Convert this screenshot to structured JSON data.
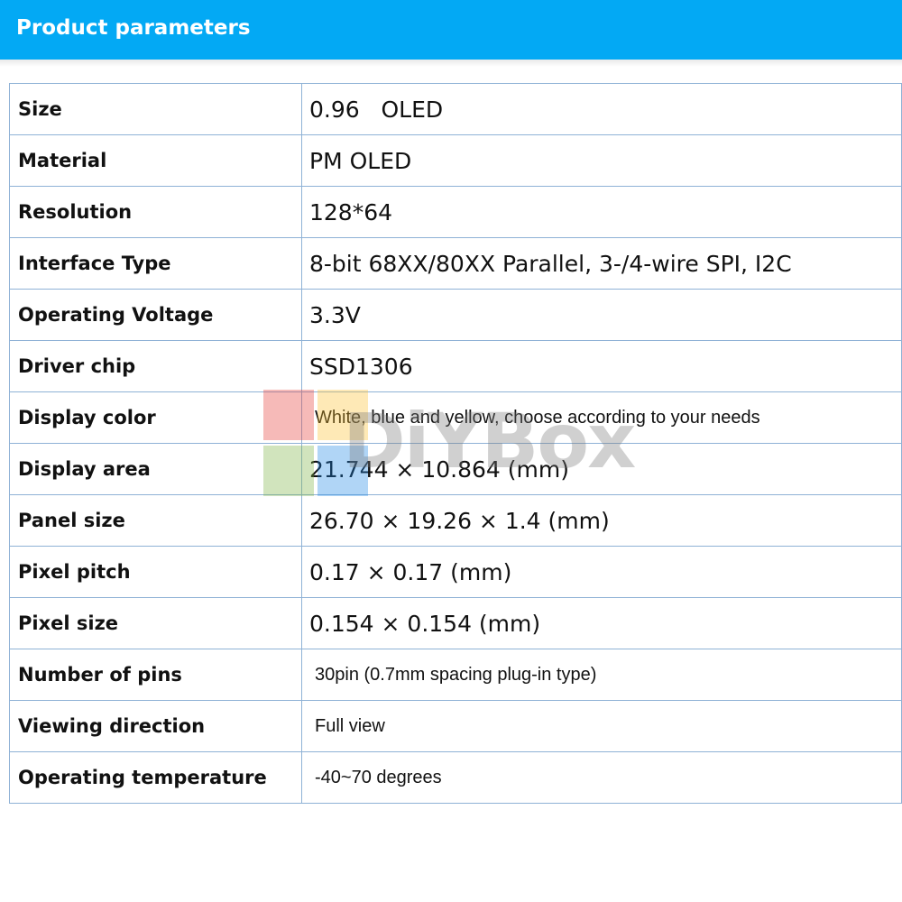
{
  "header": {
    "title": "Product parameters",
    "color": "#03a9f4"
  },
  "watermark": {
    "text": "DiYBox"
  },
  "specs": [
    {
      "label": "Size",
      "value": "0.96   OLED"
    },
    {
      "label": "Material",
      "value": "PM OLED"
    },
    {
      "label": "Resolution",
      "value": "128*64"
    },
    {
      "label": "Interface Type",
      "value": "8-bit 68XX/80XX Parallel, 3-/4-wire SPI, I2C"
    },
    {
      "label": "Operating Voltage",
      "value": "3.3V"
    },
    {
      "label": "Driver chip",
      "value": "SSD1306"
    },
    {
      "label": "Display color",
      "value": "White, blue and yellow, choose according to your needs"
    },
    {
      "label": "Display area",
      "value": "21.744 × 10.864 (mm)"
    },
    {
      "label": "Panel size",
      "value": "26.70 × 19.26 × 1.4 (mm)"
    },
    {
      "label": "Pixel pitch",
      "value": "0.17 × 0.17 (mm)"
    },
    {
      "label": "Pixel size",
      "value": "0.154 × 0.154 (mm)"
    },
    {
      "label": "Number of pins",
      "value": "30pin (0.7mm spacing plug-in type)"
    },
    {
      "label": "Viewing direction",
      "value": "Full view"
    },
    {
      "label": "Operating temperature",
      "value": "-40~70 degrees"
    }
  ]
}
